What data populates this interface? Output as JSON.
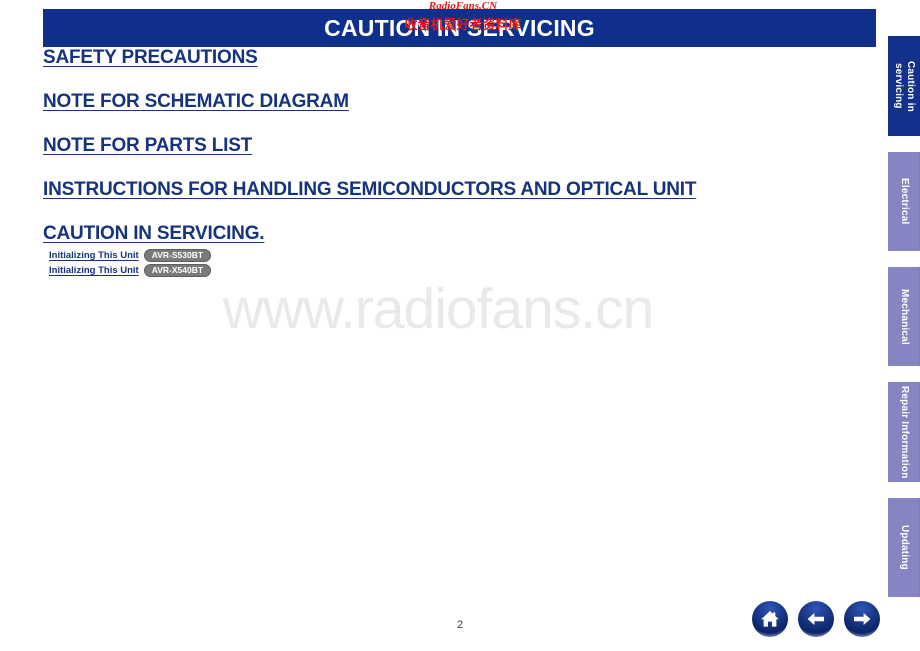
{
  "document": {
    "page_number": "2",
    "watermark_main": "www.radiofans.cn",
    "watermark_banner_latin": "RadioFans.CN",
    "watermark_banner_cjk": "收音机爱好者资料库"
  },
  "header": {
    "title": "CAUTION IN SERVICING",
    "background_color": "#0e2f8c",
    "text_color": "#ffffff"
  },
  "toc": {
    "links": [
      {
        "label": "SAFETY PRECAUTIONS"
      },
      {
        "label": "NOTE FOR SCHEMATIC DIAGRAM"
      },
      {
        "label": "NOTE FOR PARTS LIST"
      },
      {
        "label": "INSTRUCTIONS FOR HANDLING SEMICONDUCTORS AND OPTICAL UNIT"
      },
      {
        "label": "CAUTION IN SERVICING."
      }
    ],
    "sub_items": [
      {
        "label": "Initializing This Unit",
        "model": "AVR-S530BT"
      },
      {
        "label": "Initializing This Unit",
        "model": "AVR-X540BT"
      }
    ],
    "link_color": "#15337e",
    "badge_color": "#7a7a7a"
  },
  "side_tabs": [
    {
      "label": "Caution in\nservicing",
      "active": true
    },
    {
      "label": "Electrical",
      "active": false
    },
    {
      "label": "Mechanical",
      "active": false
    },
    {
      "label": "Repair Information",
      "active": false
    },
    {
      "label": "Updating",
      "active": false
    }
  ],
  "bottom_nav": [
    {
      "icon": "home-icon",
      "label": "Home"
    },
    {
      "icon": "arrow-left-icon",
      "label": "Previous"
    },
    {
      "icon": "arrow-right-icon",
      "label": "Next"
    }
  ],
  "colors": {
    "accent_navy": "#15337e",
    "tab_inactive": "#8585c4",
    "tab_active": "#12318c",
    "watermark_red": "#e11b1b",
    "watermark_gray": "#e9e9e9"
  }
}
